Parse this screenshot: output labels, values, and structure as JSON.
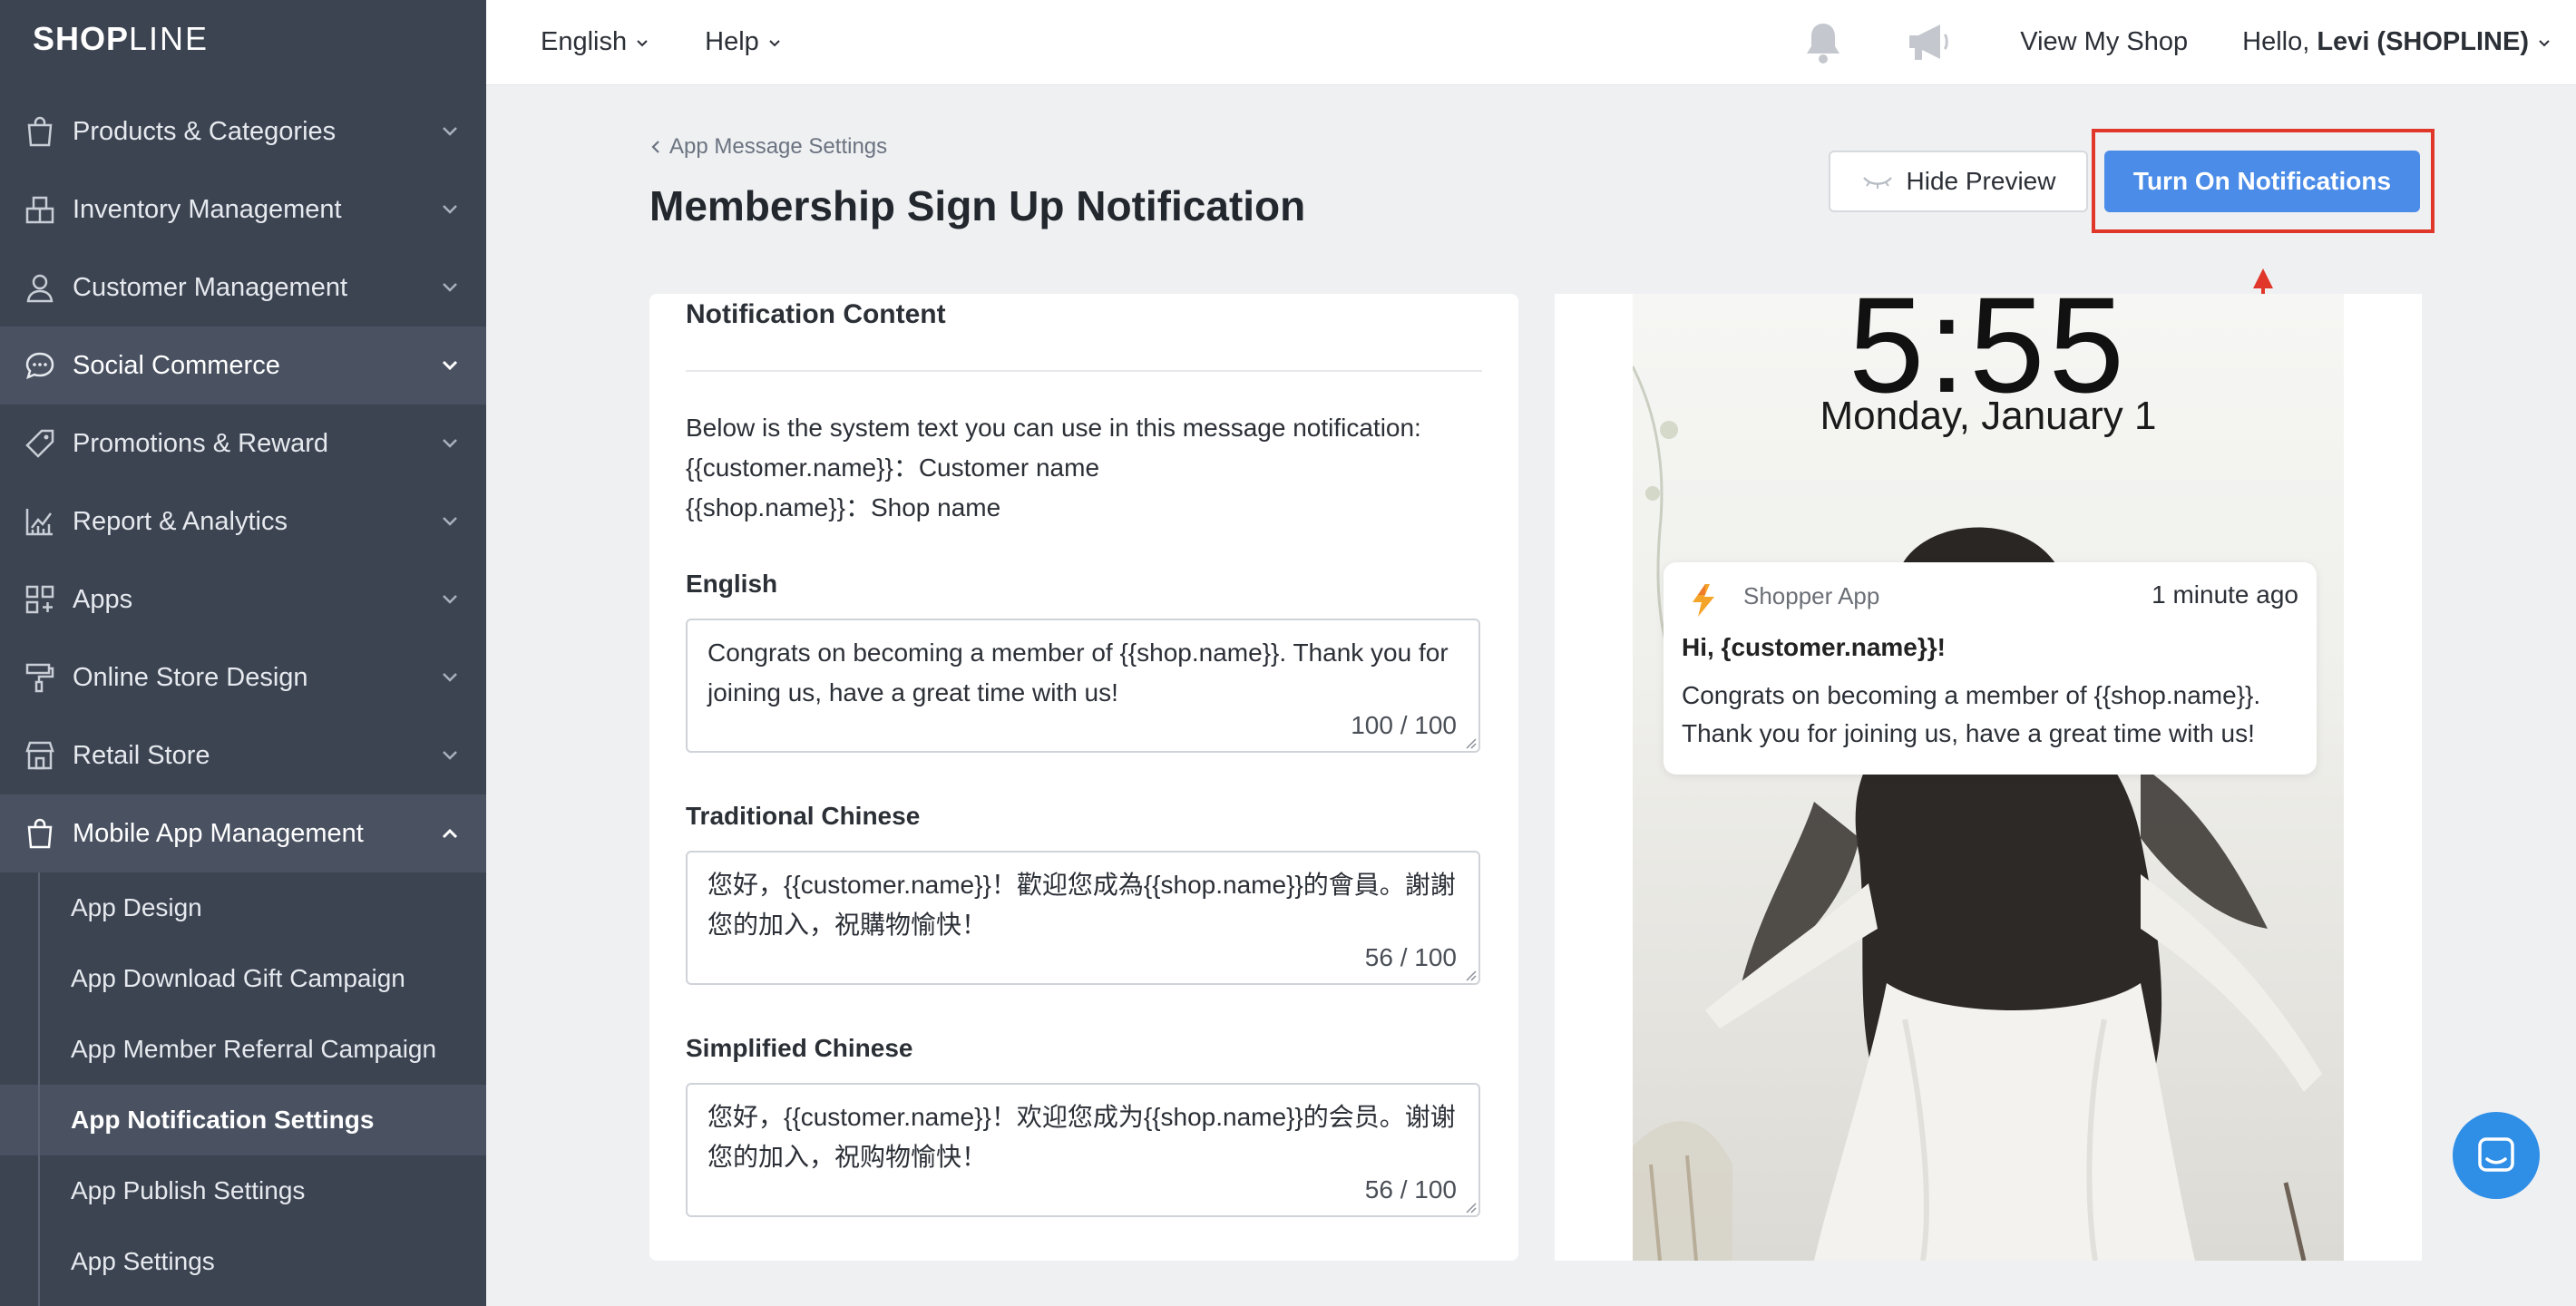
{
  "sidebar": {
    "logo": {
      "bold": "SHOP",
      "thin": "LINE"
    },
    "items": [
      {
        "label": "Products & Categories",
        "icon": "shopping-bag-icon"
      },
      {
        "label": "Inventory Management",
        "icon": "inventory-icon"
      },
      {
        "label": "Customer Management",
        "icon": "user-icon"
      },
      {
        "label": "Social Commerce",
        "icon": "chat-bubble-icon"
      },
      {
        "label": "Promotions & Reward",
        "icon": "tag-icon"
      },
      {
        "label": "Report & Analytics",
        "icon": "chart-icon"
      },
      {
        "label": "Apps",
        "icon": "apps-grid-icon"
      },
      {
        "label": "Online Store Design",
        "icon": "paint-roller-icon"
      },
      {
        "label": "Retail Store",
        "icon": "store-icon"
      },
      {
        "label": "Mobile App Management",
        "icon": "shopping-bag-icon"
      }
    ],
    "subitems": [
      {
        "label": "App Design"
      },
      {
        "label": "App Download Gift Campaign"
      },
      {
        "label": "App Member Referral Campaign"
      },
      {
        "label": "App Notification Settings"
      },
      {
        "label": "App Publish Settings"
      },
      {
        "label": "App Settings"
      }
    ]
  },
  "topbar": {
    "language": "English",
    "help": "Help",
    "view_shop": "View My Shop",
    "hello_prefix": "Hello, ",
    "user": "Levi (SHOPLINE)"
  },
  "header": {
    "breadcrumb": "App Message Settings",
    "title": "Membership Sign Up Notification",
    "hide_preview": "Hide Preview",
    "turn_on": "Turn On Notifications"
  },
  "form": {
    "section_title": "Notification Content",
    "info_lines": [
      "Below is the system text you can use in this message notification:",
      "{{customer.name}}：Customer name",
      "{{shop.name}}：Shop name"
    ],
    "fields": [
      {
        "label": "English",
        "value": "Congrats on becoming a member of {{shop.name}}. Thank you for joining us, have a great time with us!",
        "count": "100 / 100"
      },
      {
        "label": "Traditional Chinese",
        "value": "您好，{{customer.name}}！歡迎您成為{{shop.name}}的會員。謝謝您的加入，祝購物愉快！",
        "count": "56 / 100"
      },
      {
        "label": "Simplified Chinese",
        "value": "您好，{{customer.name}}！欢迎您成为{{shop.name}}的会员。谢谢您的加入，祝购物愉快！",
        "count": "56 / 100"
      }
    ]
  },
  "preview": {
    "clock": "5:55",
    "date": "Monday, January 1",
    "app_name": "Shopper App",
    "time": "1 minute ago",
    "title": "Hi, {customer.name}}!",
    "body": "Congrats on becoming a member of {{shop.name}}. Thank you for joining us, have a great time with us!"
  },
  "colors": {
    "sidebar_bg": "#3c4452",
    "primary": "#4a8ce8",
    "highlight": "#e1372b",
    "chat": "#2f8ee6"
  }
}
